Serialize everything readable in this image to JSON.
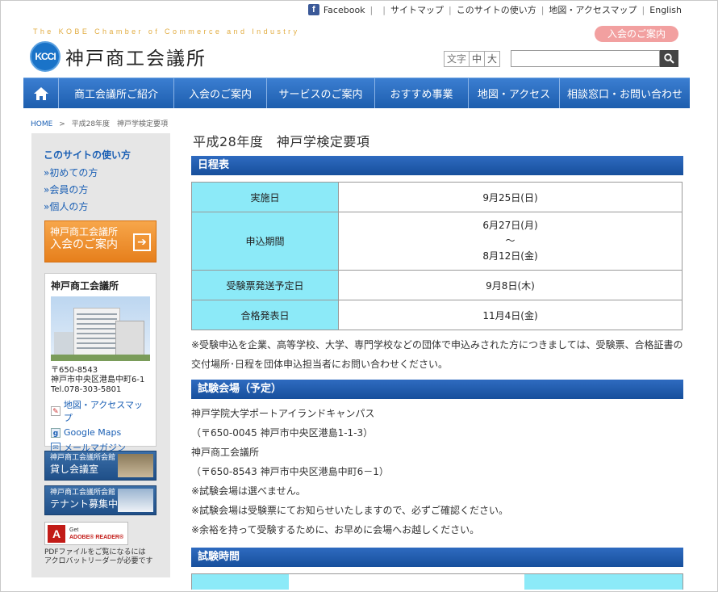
{
  "top_links": {
    "facebook": "Facebook",
    "sitemap": "サイトマップ",
    "howto": "このサイトの使い方",
    "access": "地図・アクセスマップ",
    "english": "English"
  },
  "header": {
    "tagline": "The KOBE Chamber of Commerce and Industry",
    "logo_mark": "KCCI",
    "logo_text": "神戸商工会議所",
    "join_button": "入会のご案内",
    "font_size_label": "文字",
    "font_mid": "中",
    "font_large": "大",
    "search_placeholder": ""
  },
  "nav": [
    "商工会議所ご紹介",
    "入会のご案内",
    "サービスのご案内",
    "おすすめ事業",
    "地図・アクセス",
    "相談窓口・お問い合わせ"
  ],
  "breadcrumb": {
    "home": "HOME",
    "sep": ">",
    "current": "平成28年度　神戸学検定要項"
  },
  "sidebar": {
    "title": "このサイトの使い方",
    "links": [
      "»初めての方",
      "»会員の方",
      "»個人の方"
    ],
    "banner_line1": "神戸商工会議所",
    "banner_line2": "入会のご案内",
    "box_title": "神戸商工会議所",
    "postal": "〒650-8543",
    "address": "神戸市中央区港島中町6-1",
    "tel": "Tel.078-303-5801",
    "link_map": "地図・アクセスマップ",
    "link_gmaps": "Google Maps",
    "link_mail": "メールマガジン",
    "ban2_small": "神戸商工会議所会館",
    "ban2_large": "貸し会議室",
    "ban3_small": "神戸商工会議所会館",
    "ban3_large": "テナント募集中",
    "adobe_get": "Get",
    "adobe_name": "ADOBE® READER®",
    "pdf_note_1": "PDFファイルをご覧になるには",
    "pdf_note_2": "アクロバットリーダーが必要です"
  },
  "main": {
    "page_title": "平成28年度　神戸学検定要項",
    "sec_schedule": "日程表",
    "schedule": [
      {
        "label": "実施日",
        "value": "9月25日(日)"
      },
      {
        "label": "申込期間",
        "value_1": "6月27日(月)",
        "value_2": "～",
        "value_3": "8月12日(金)"
      },
      {
        "label": "受験票発送予定日",
        "value": "9月8日(木)"
      },
      {
        "label": "合格発表日",
        "value": "11月4日(金)"
      }
    ],
    "note": "※受験申込を企業、高等学校、大学、専門学校などの団体で申込みされた方につきましては、受験票、合格証書の交付場所･日程を団体申込担当者にお問い合わせください。",
    "sec_venue": "試験会場（予定）",
    "venue_lines": [
      "神戸学院大学ポートアイランドキャンパス",
      "（〒650-0045 神戸市中央区港島1-1-3）",
      "神戸商工会議所",
      "（〒650-8543 神戸市中央区港島中町6－1）",
      "※試験会場は選べません。",
      "※試験会場は受験票にてお知らせいたしますので、必ずご確認ください。",
      "※余裕を持って受験するために、お早めに会場へお越しください。"
    ],
    "sec_time": "試験時間"
  }
}
